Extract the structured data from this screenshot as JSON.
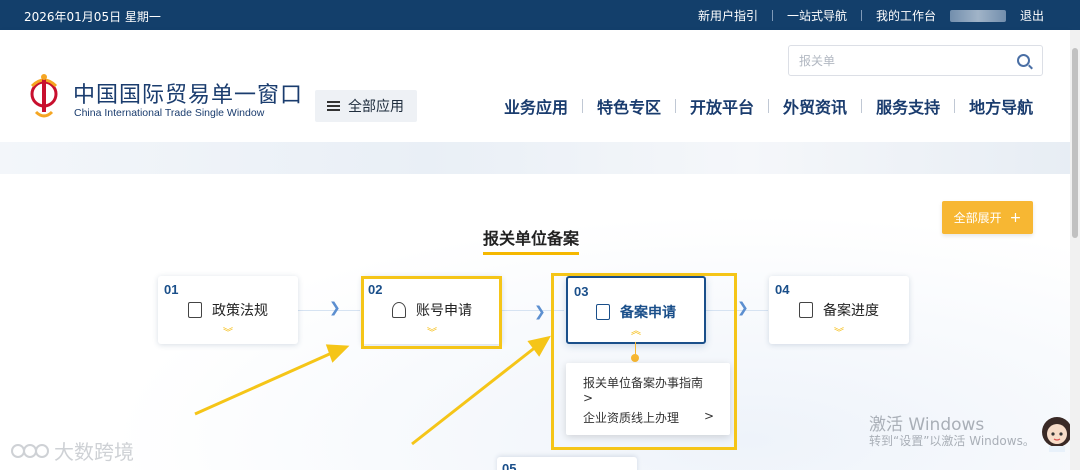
{
  "topbar": {
    "date": "2026年01月05日 星期一",
    "links": [
      "新用户指引",
      "一站式导航",
      "我的工作台"
    ],
    "logout": "退出"
  },
  "header": {
    "brand_cn": "中国国际贸易单一窗口",
    "brand_en": "China International Trade Single Window",
    "all_apps_label": "全部应用",
    "search_placeholder": "报关单",
    "nav": [
      "业务应用",
      "特色专区",
      "开放平台",
      "外贸资讯",
      "服务支持",
      "地方导航"
    ]
  },
  "main": {
    "section_title": "报关单位备案",
    "expand_button": "全部展开",
    "expand_icon": "+",
    "steps": [
      {
        "num": "01",
        "label": "政策法规",
        "icon": "document-icon"
      },
      {
        "num": "02",
        "label": "账号申请",
        "icon": "user-icon"
      },
      {
        "num": "03",
        "label": "备案申请",
        "icon": "edit-icon"
      },
      {
        "num": "04",
        "label": "备案进度",
        "icon": "search-doc-icon"
      },
      {
        "num": "05"
      }
    ],
    "dropdown": [
      {
        "label": "报关单位备案办事指南 >"
      },
      {
        "label": "企业资质线上办理",
        "arrow": ">"
      }
    ]
  },
  "watermarks": {
    "activate_title": "激活 Windows",
    "activate_sub": "转到“设置”以激活 Windows。",
    "brand": "大数跨境"
  },
  "colors": {
    "topbar": "#133f6b",
    "brand_blue": "#1a3c6e",
    "accent_yellow": "#f5c518",
    "expand_button": "#f7b733"
  }
}
